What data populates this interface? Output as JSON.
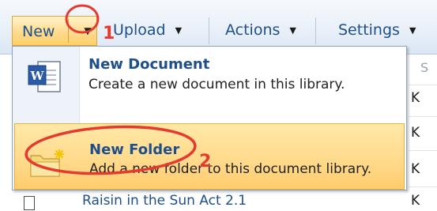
{
  "toolbar": {
    "new_label": "New",
    "upload_label": "Upload",
    "actions_label": "Actions",
    "settings_label": "Settings"
  },
  "menu": {
    "items": [
      {
        "title": "New Document",
        "description": "Create a new document in this library.",
        "icon": "word-document-icon"
      },
      {
        "title": "New Folder",
        "description": "Add a new folder to this document library.",
        "icon": "new-folder-icon"
      }
    ]
  },
  "list": {
    "column_header": "S",
    "row_letters": [
      "K",
      "K",
      "K",
      "K"
    ],
    "last_row_title": "Raisin in the Sun Act 2.1"
  },
  "annotations": {
    "marker_1": "1",
    "marker_2": "2",
    "color": "#e53a2f"
  },
  "colors": {
    "accent_text": "#1f4f8b",
    "highlight": "#ffd98a"
  }
}
